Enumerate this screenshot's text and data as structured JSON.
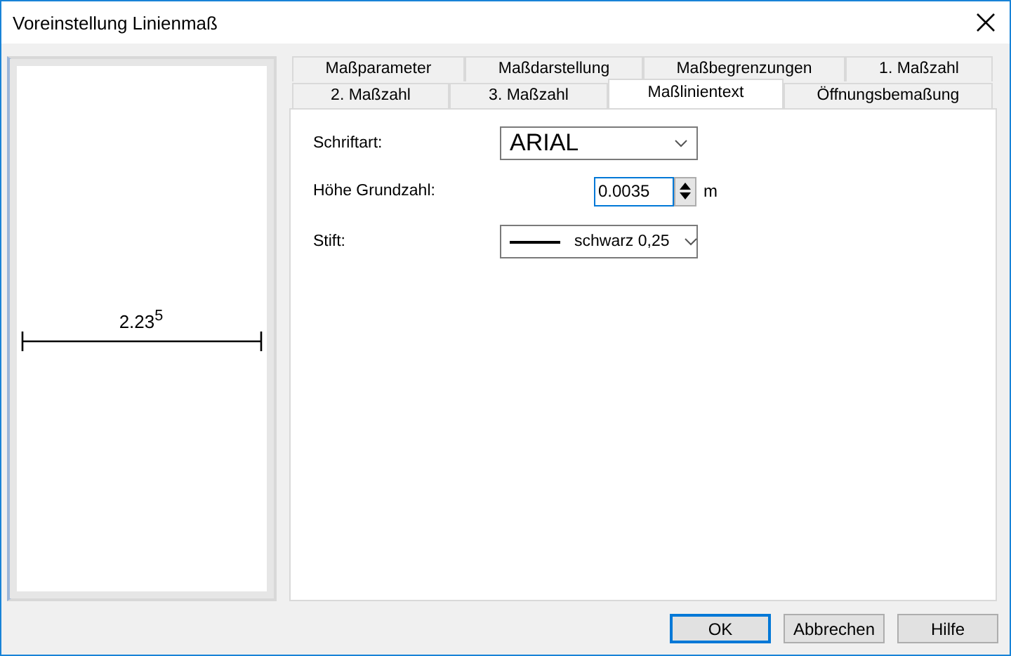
{
  "window": {
    "title": "Voreinstellung Linienmaß"
  },
  "preview": {
    "dimension_text": "2.23$^{5}$"
  },
  "tab_rows": [
    [
      {
        "label": "Maßparameter",
        "selected": false
      },
      {
        "label": "Maßdarstellung",
        "selected": false
      },
      {
        "label": "Maßbegrenzungen",
        "selected": false
      },
      {
        "label": "1. Maßzahl",
        "selected": false
      }
    ],
    [
      {
        "label": "2. Maßzahl",
        "selected": false
      },
      {
        "label": "3. Maßzahl",
        "selected": false
      },
      {
        "label": "Maßlinientext",
        "selected": true
      },
      {
        "label": "Öffnungsbemaßung",
        "selected": false
      }
    ]
  ],
  "fields": [
    {
      "kind": "font",
      "label": "Schriftart:",
      "value": "ARIAL"
    },
    {
      "kind": "spin",
      "label": "Höhe Grundzahl:",
      "value": "0.0035",
      "unit": "m"
    },
    {
      "kind": "pen",
      "label": "Stift:",
      "value": "schwarz 0,25"
    }
  ],
  "buttons": [
    {
      "label": "OK",
      "default": true
    },
    {
      "label": "Abbrechen",
      "default": false
    },
    {
      "label": "Hilfe",
      "default": false
    }
  ]
}
